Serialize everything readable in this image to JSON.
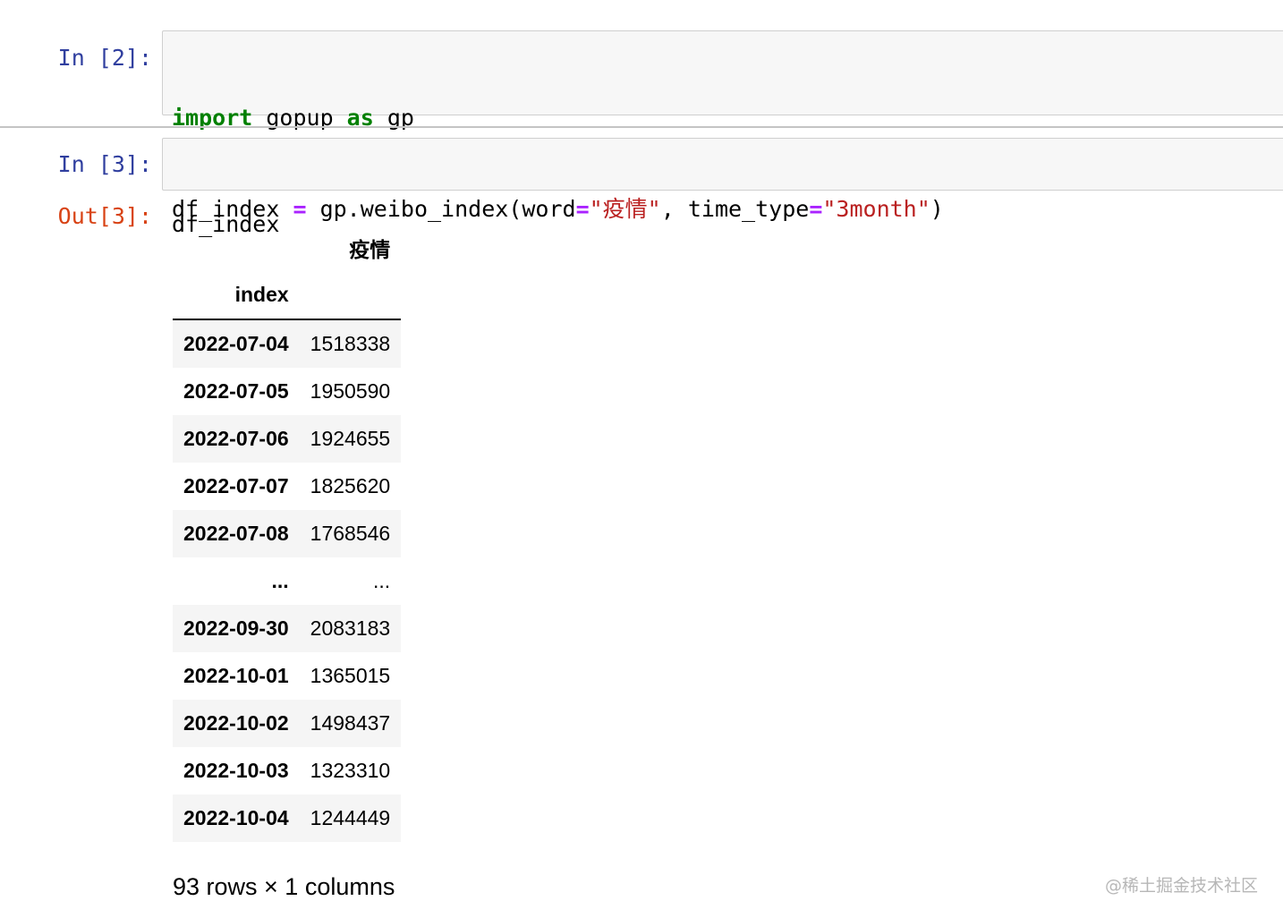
{
  "cells": [
    {
      "prompt": "In [2]:",
      "code_lines": [
        [
          {
            "t": "import",
            "c": "kw"
          },
          {
            "t": " gopup ",
            "c": "txt"
          },
          {
            "t": "as",
            "c": "kw"
          },
          {
            "t": " gp",
            "c": "txt"
          }
        ],
        [
          {
            "t": "df_index ",
            "c": "txt"
          },
          {
            "t": "=",
            "c": "op"
          },
          {
            "t": " gp.weibo_index(word",
            "c": "txt"
          },
          {
            "t": "=",
            "c": "op"
          },
          {
            "t": "\"疫情\"",
            "c": "str"
          },
          {
            "t": ", time_type",
            "c": "txt"
          },
          {
            "t": "=",
            "c": "op"
          },
          {
            "t": "\"3month\"",
            "c": "str"
          },
          {
            "t": ")",
            "c": "txt"
          }
        ]
      ]
    },
    {
      "prompt": "In [3]:",
      "code_lines": [
        [
          {
            "t": "df_index",
            "c": "txt"
          }
        ]
      ]
    }
  ],
  "output": {
    "prompt": "Out[3]:",
    "column_header": "疫情",
    "index_name": "index",
    "rows": [
      {
        "index": "2022-07-04",
        "value": "1518338"
      },
      {
        "index": "2022-07-05",
        "value": "1950590"
      },
      {
        "index": "2022-07-06",
        "value": "1924655"
      },
      {
        "index": "2022-07-07",
        "value": "1825620"
      },
      {
        "index": "2022-07-08",
        "value": "1768546"
      },
      {
        "index": "...",
        "value": "..."
      },
      {
        "index": "2022-09-30",
        "value": "2083183"
      },
      {
        "index": "2022-10-01",
        "value": "1365015"
      },
      {
        "index": "2022-10-02",
        "value": "1498437"
      },
      {
        "index": "2022-10-03",
        "value": "1323310"
      },
      {
        "index": "2022-10-04",
        "value": "1244449"
      }
    ],
    "shape_text": "93 rows × 1 columns"
  },
  "watermark": "@稀土掘金技术社区"
}
